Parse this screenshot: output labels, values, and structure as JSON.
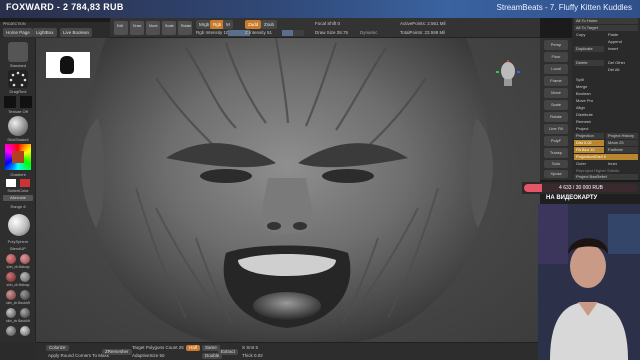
{
  "stream": {
    "channel": "FOXWARD",
    "donation_total": "2 784,83 RUB",
    "title": "StreamBeats - 7. Fluffy Kitten Kuddles"
  },
  "docbar": {
    "projection": "PROJECTION",
    "home": "Home Page",
    "lightbox": "LightBox",
    "live_boolean": "Live Boolean"
  },
  "topbar": {
    "buttons": {
      "mrgb": "Mrgb",
      "rgb": "Rgb",
      "m": "M",
      "zadd": "Zadd",
      "zsub": "Zsub",
      "edit": "Edit",
      "draw": "Draw",
      "move": "Move",
      "scale": "Scale",
      "rotate": "Rotate"
    },
    "rgb_intensity": "Rgb Intensity 100",
    "z_intensity": "Z Intensity 51",
    "focal_shift": "Focal Shift 0",
    "draw_size": "Draw Size 28.75",
    "active_points": "ActivePoints: 2.561 Mil",
    "total_points": "TotalPoints: 23.598 Mil",
    "dynamic": "Dynamic"
  },
  "leftshelf": {
    "brush": "Standard",
    "stroke": "DragRect",
    "alpha": "Off",
    "texture": "Texture Off",
    "material": "SkinShade4",
    "gradient": "Gradient",
    "switch_color": "SwitchColor",
    "alternate": "Alternate",
    "range": "Range 8",
    "polysphere": "PolySphere",
    "blend": "BlendUP",
    "matcaps": [
      "skin_zb Matcap",
      "skin_zb Matcap",
      "skin_zb BasicMt",
      "skin_zb BasicMt"
    ]
  },
  "bottombar": {
    "colorize": "Colorize",
    "apply_round": "Apply Round Corners To Mask",
    "zremesher": "ZRemesher",
    "target_polygons": "Target Polygons Count 25",
    "adapt": "AdaptiveSize 50",
    "half": "Half",
    "same": "Same",
    "double": "Double",
    "extract": "Extract",
    "thick": "Thick 0.02",
    "s_smt": "S Smt 5"
  },
  "rightpanel": {
    "top_items": [
      "All To Home",
      "All To Target",
      "Copy",
      "Paste",
      "Append",
      "Duplicate",
      "Insert",
      "Delete",
      "Del Other",
      "Del All"
    ],
    "menu_items": [
      "Split",
      "Merge",
      "Boolean",
      "Move Pro",
      "Align",
      "Distribute",
      "Remesh",
      "Project",
      "Projection",
      "Project History",
      "Dist 0.02",
      "Mean 25",
      "PA Blur 10",
      "Farthest",
      "ProjectionShell 0"
    ],
    "extra": [
      "Outer",
      "Inner",
      "Reproject Higher Subdiv",
      "Project BasRelief",
      "Extract"
    ],
    "tools": [
      "Persp",
      "Floor",
      "Local",
      "Frame",
      "Move",
      "Scale",
      "Rotate",
      "Line Fill",
      "PolyF",
      "Transp",
      "Ghost",
      "Solo",
      "Xpose"
    ]
  },
  "donation": {
    "text": "4 633 / 30 000 RUB",
    "progress": 0.154
  },
  "card": {
    "text": "НА ВИДЕОКАРТУ"
  },
  "colors": {
    "accent": "#c97a2b",
    "donation_fill": "#e45567",
    "banner": "#3a63a0"
  }
}
